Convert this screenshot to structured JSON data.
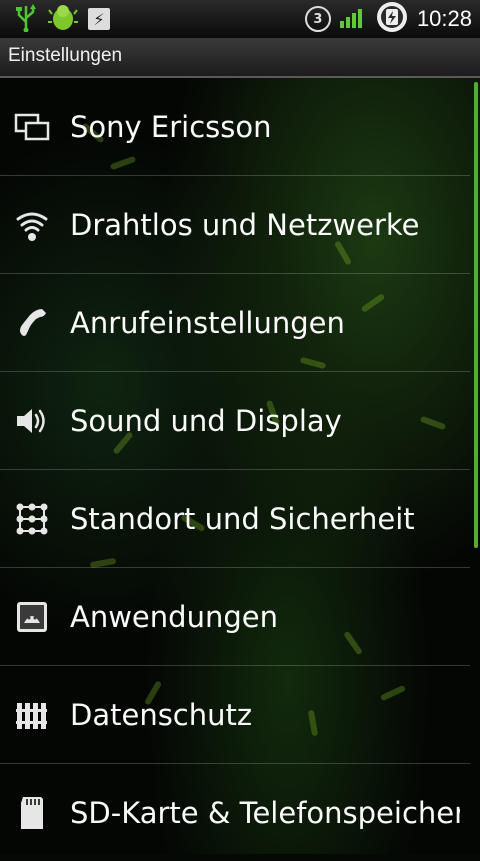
{
  "status_bar": {
    "time": "10:28",
    "notification_badge": "3",
    "icons": [
      "usb-icon",
      "debug-bug-icon",
      "flash-icon",
      "sync-badge-icon",
      "signal-icon",
      "battery-charging-icon"
    ]
  },
  "title_bar": {
    "title": "Einstellungen"
  },
  "settings": {
    "items": [
      {
        "label": "Sony Ericsson",
        "icon": "sony-ericsson-icon"
      },
      {
        "label": "Drahtlos und Netzwerke",
        "icon": "wireless-icon"
      },
      {
        "label": "Anrufeinstellungen",
        "icon": "phone-icon"
      },
      {
        "label": "Sound und Display",
        "icon": "speaker-icon"
      },
      {
        "label": "Standort und Sicherheit",
        "icon": "location-security-icon"
      },
      {
        "label": "Anwendungen",
        "icon": "applications-icon"
      },
      {
        "label": "Datenschutz",
        "icon": "privacy-icon"
      },
      {
        "label": "SD-Karte & Telefonspeicher",
        "icon": "sd-card-icon"
      }
    ]
  },
  "colors": {
    "accent": "#4fb030",
    "background": "#040604"
  }
}
